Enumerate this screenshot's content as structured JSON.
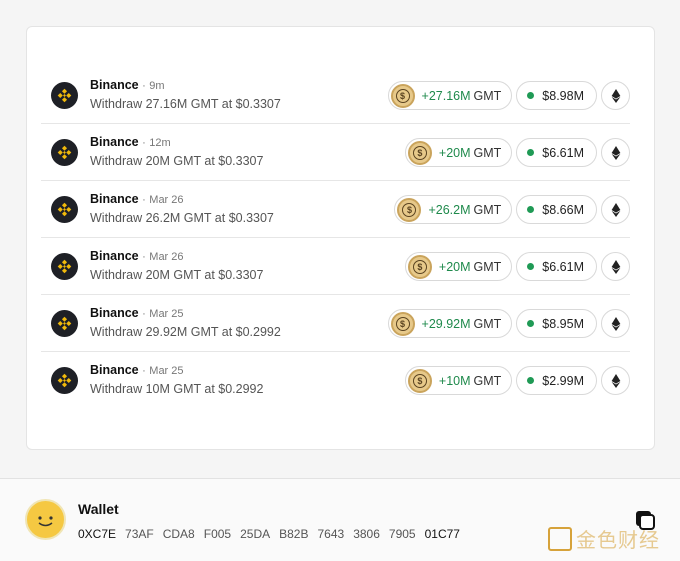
{
  "transactions": [
    {
      "exchange": "Binance",
      "time": "9m",
      "desc": "Withdraw 27.16M GMT at $0.3307",
      "qty": "+27.16M",
      "symbol": "GMT",
      "usd": "$8.98M"
    },
    {
      "exchange": "Binance",
      "time": "12m",
      "desc": "Withdraw 20M GMT at $0.3307",
      "qty": "+20M",
      "symbol": "GMT",
      "usd": "$6.61M"
    },
    {
      "exchange": "Binance",
      "time": "Mar 26",
      "desc": "Withdraw 26.2M GMT at $0.3307",
      "qty": "+26.2M",
      "symbol": "GMT",
      "usd": "$8.66M"
    },
    {
      "exchange": "Binance",
      "time": "Mar 26",
      "desc": "Withdraw 20M GMT at $0.3307",
      "qty": "+20M",
      "symbol": "GMT",
      "usd": "$6.61M"
    },
    {
      "exchange": "Binance",
      "time": "Mar 25",
      "desc": "Withdraw 29.92M GMT at $0.2992",
      "qty": "+29.92M",
      "symbol": "GMT",
      "usd": "$8.95M"
    },
    {
      "exchange": "Binance",
      "time": "Mar 25",
      "desc": "Withdraw 10M GMT at $0.2992",
      "qty": "+10M",
      "symbol": "GMT",
      "usd": "$2.99M"
    }
  ],
  "separator": "·",
  "icons": {
    "exchange": "binance-logo-icon",
    "coin": "gmt-coin-icon",
    "chain": "ethereum-icon",
    "copy": "copy-icon"
  },
  "colors": {
    "positive": "#1f8a4c",
    "dot": "#1f9a55",
    "binance": "#f0b90b"
  },
  "wallet": {
    "title": "Wallet",
    "address_groups": [
      "0XC7E",
      "73AF",
      "CDA8",
      "F005",
      "25DA",
      "B82B",
      "7643",
      "3806",
      "7905",
      "01C77"
    ]
  },
  "watermark": "金色财经"
}
